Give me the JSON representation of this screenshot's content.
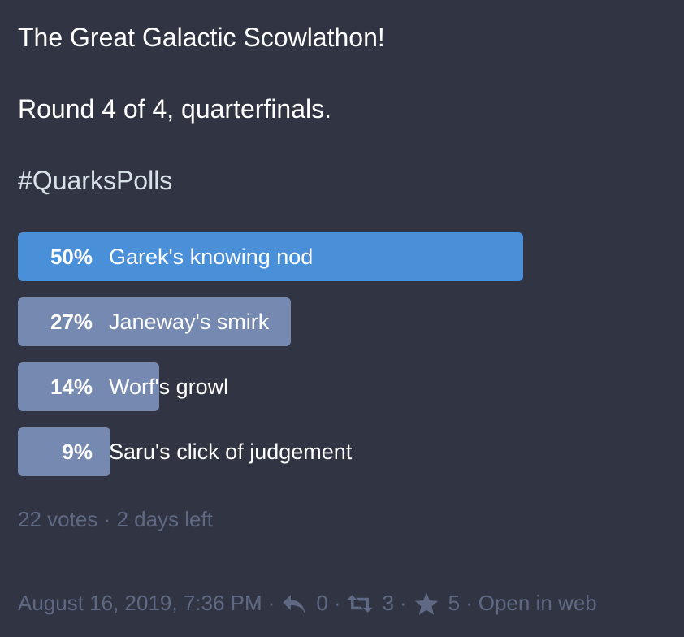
{
  "status": {
    "title_line": "The Great Galactic Scowlathon!",
    "round_line": "Round 4 of 4, quarterfinals.",
    "hashtag": "#QuarksPolls"
  },
  "poll": {
    "options": [
      {
        "percent": "50%",
        "label": "Garek's knowing nod",
        "value": 0.5,
        "leading": true
      },
      {
        "percent": "27%",
        "label": "Janeway's smirk",
        "value": 0.27,
        "leading": false
      },
      {
        "percent": "14%",
        "label": "Worf's growl",
        "value": 0.14,
        "leading": false
      },
      {
        "percent": "9%",
        "label": "Saru's click of judgement",
        "value": 0.09,
        "leading": false
      }
    ],
    "votes": "22 votes",
    "separator": "·",
    "time_left": "2 days left"
  },
  "meta": {
    "date": "August 16, 2019, 7:36 PM",
    "separator": "·",
    "reply_icon": "reply-icon",
    "reply_count": "0",
    "boost_icon": "boost-icon",
    "boost_count": "3",
    "favourite_icon": "star-icon",
    "favourite_count": "5",
    "open_in_web": "Open in web"
  },
  "colors": {
    "background": "#313543",
    "leading_bar": "#4a90d9",
    "bar": "#7689b0",
    "muted_text": "#606984",
    "hashtag": "#d9e1e8"
  }
}
